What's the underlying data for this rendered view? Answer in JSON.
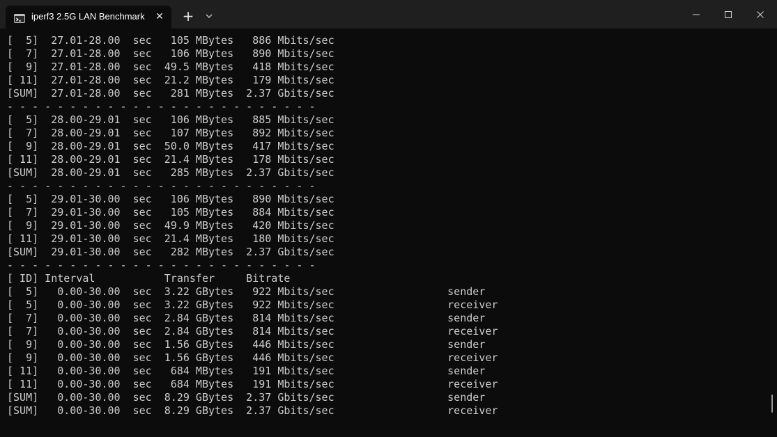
{
  "window": {
    "tab_title": "iperf3 2.5G LAN Benchmark",
    "tab_close_glyph": "✕",
    "new_tab_glyph": "+",
    "icons": {
      "tab": "terminal-icon",
      "dropdown": "chevron-down-icon",
      "minimize": "minimize-icon",
      "maximize": "maximize-icon",
      "close": "close-icon"
    },
    "colors": {
      "titlebar": "#1f1f1f",
      "background": "#0c0c0c",
      "text": "#cccccc"
    }
  },
  "terminal": {
    "lines": [
      "[  5]  27.01-28.00  sec   105 MBytes   886 Mbits/sec",
      "[  7]  27.01-28.00  sec   106 MBytes   890 Mbits/sec",
      "[  9]  27.01-28.00  sec  49.5 MBytes   418 Mbits/sec",
      "[ 11]  27.01-28.00  sec  21.2 MBytes   179 Mbits/sec",
      "[SUM]  27.01-28.00  sec   281 MBytes  2.37 Gbits/sec",
      "- - - - - - - - - - - - - - - - - - - - - - - - -",
      "[  5]  28.00-29.01  sec   106 MBytes   885 Mbits/sec",
      "[  7]  28.00-29.01  sec   107 MBytes   892 Mbits/sec",
      "[  9]  28.00-29.01  sec  50.0 MBytes   417 Mbits/sec",
      "[ 11]  28.00-29.01  sec  21.4 MBytes   178 Mbits/sec",
      "[SUM]  28.00-29.01  sec   285 MBytes  2.37 Gbits/sec",
      "- - - - - - - - - - - - - - - - - - - - - - - - -",
      "[  5]  29.01-30.00  sec   106 MBytes   890 Mbits/sec",
      "[  7]  29.01-30.00  sec   105 MBytes   884 Mbits/sec",
      "[  9]  29.01-30.00  sec  49.9 MBytes   420 Mbits/sec",
      "[ 11]  29.01-30.00  sec  21.4 MBytes   180 Mbits/sec",
      "[SUM]  29.01-30.00  sec   282 MBytes  2.37 Gbits/sec",
      "- - - - - - - - - - - - - - - - - - - - - - - - -",
      "[ ID] Interval           Transfer     Bitrate",
      "[  5]   0.00-30.00  sec  3.22 GBytes   922 Mbits/sec                  sender",
      "[  5]   0.00-30.00  sec  3.22 GBytes   922 Mbits/sec                  receiver",
      "[  7]   0.00-30.00  sec  2.84 GBytes   814 Mbits/sec                  sender",
      "[  7]   0.00-30.00  sec  2.84 GBytes   814 Mbits/sec                  receiver",
      "[  9]   0.00-30.00  sec  1.56 GBytes   446 Mbits/sec                  sender",
      "[  9]   0.00-30.00  sec  1.56 GBytes   446 Mbits/sec                  receiver",
      "[ 11]   0.00-30.00  sec   684 MBytes   191 Mbits/sec                  sender",
      "[ 11]   0.00-30.00  sec   684 MBytes   191 Mbits/sec                  receiver",
      "[SUM]   0.00-30.00  sec  8.29 GBytes  2.37 Gbits/sec                  sender",
      "[SUM]   0.00-30.00  sec  8.29 GBytes  2.37 Gbits/sec                  receiver"
    ]
  }
}
